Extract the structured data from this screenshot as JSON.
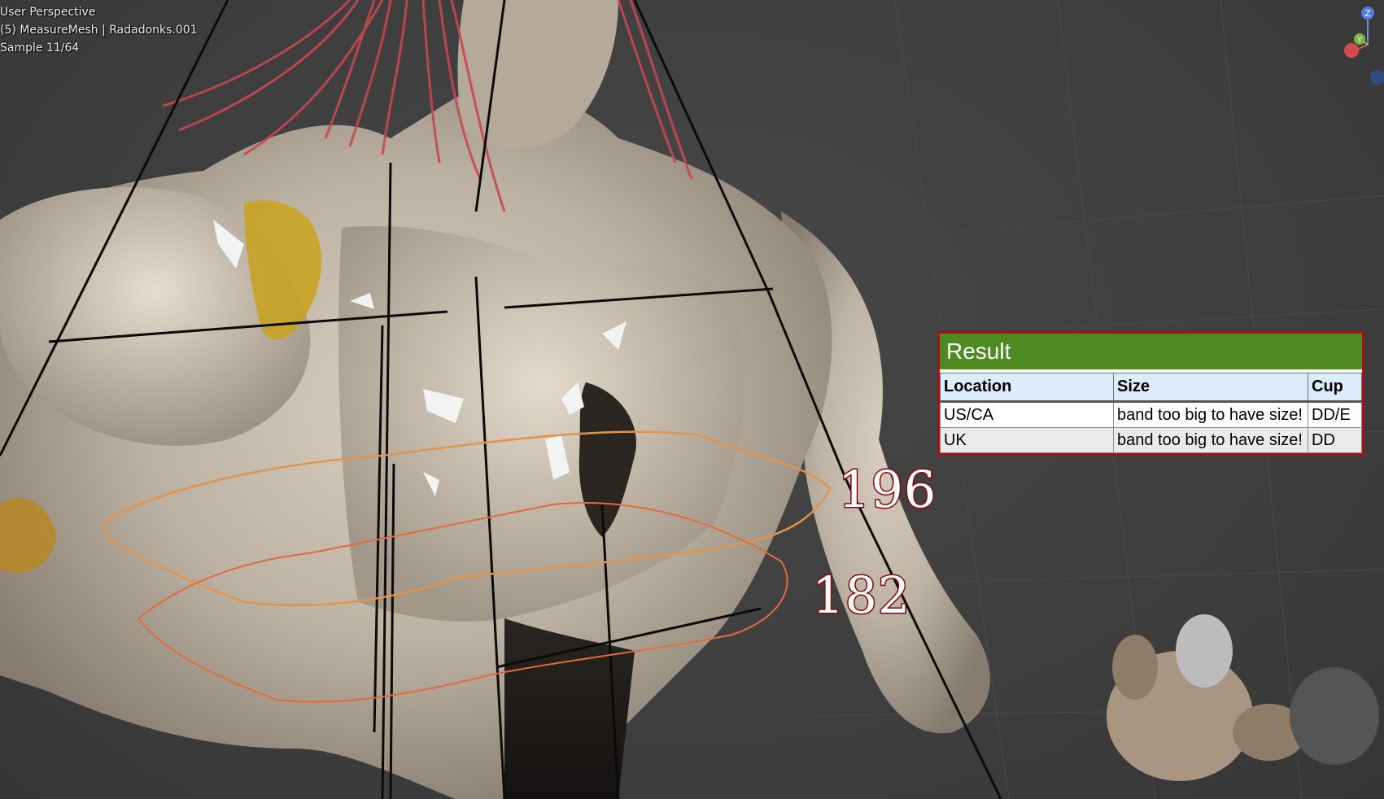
{
  "viewport": {
    "hud": {
      "view_name": "User Perspective",
      "object_info": "(5) MeasureMesh | Radadonks.001",
      "sample": "Sample 11/64"
    },
    "gizmo": {
      "z_label": "Z",
      "y_label": "Y"
    },
    "measurements": {
      "upper": "196",
      "lower": "182"
    }
  },
  "result_panel": {
    "title": "Result",
    "columns": [
      "Location",
      "Size",
      "Cup"
    ],
    "rows": [
      {
        "location": "US/CA",
        "size": "band too big to have size!",
        "cup": "DD/E"
      },
      {
        "location": "UK",
        "size": "band too big to have size!",
        "cup": "DD"
      }
    ]
  },
  "colors": {
    "result_header": "#4e8a22",
    "result_border": "#a01414",
    "measure_text_stroke": "#8b0a0f",
    "column_header_bg": "#dcecfb"
  }
}
